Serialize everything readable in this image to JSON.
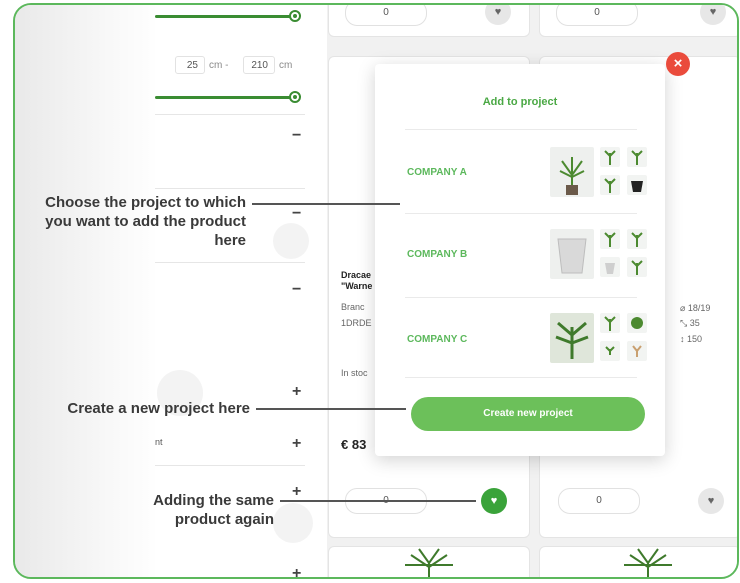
{
  "filters": {
    "range_min": "25",
    "range_unit_1": "cm -",
    "range_max": "210",
    "range_unit_2": "cm",
    "minus": "−",
    "plus": "+",
    "partial_label": "nt"
  },
  "product": {
    "name_line1": "Dracae",
    "name_line2": "\"Warne",
    "detail1": "Branc",
    "detail2": "1DRDE",
    "stock": "In stoc",
    "price": "€ 83",
    "spec_diameter": "⌀ 18/19",
    "spec_span": "⤡ 35",
    "spec_height": "↕ 150",
    "qty_value": "0",
    "qty_plus": "+"
  },
  "modal": {
    "title": "Add to project",
    "companies": [
      "COMPANY A",
      "COMPANY B",
      "COMPANY C"
    ],
    "create_label": "Create new project",
    "close": "×"
  },
  "callouts": {
    "choose": "Choose the project to which you want to add the product here",
    "create": "Create a new project here",
    "same": "Adding the same product again"
  },
  "icons": {
    "heart": "♥"
  },
  "colors": {
    "accent": "#5cb85c",
    "close": "#ea4b3c"
  }
}
